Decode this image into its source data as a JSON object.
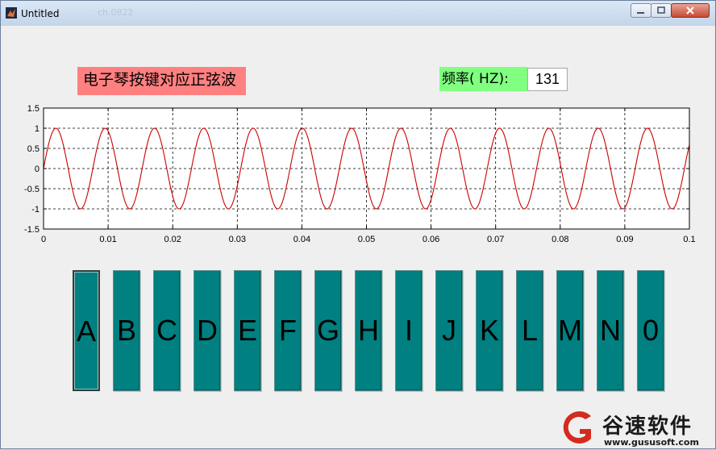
{
  "window": {
    "title": "Untitled",
    "ghost_text": "ch.0822"
  },
  "labels": {
    "heading": "电子琴按键对应正弦波",
    "freq_label": "频率( HZ):",
    "freq_value": "131"
  },
  "keys": [
    "A",
    "B",
    "C",
    "D",
    "E",
    "F",
    "G",
    "H",
    "I",
    "J",
    "K",
    "L",
    "M",
    "N",
    "0"
  ],
  "colors": {
    "key_fill": "#008080",
    "heading_bg": "#ff8080",
    "freq_label_bg": "#80ff80",
    "curve": "#cc0000"
  },
  "watermark": {
    "name": "谷速软件",
    "url": "www.gususoft.com"
  },
  "chart_data": {
    "type": "line",
    "title": "",
    "xlabel": "",
    "ylabel": "",
    "xlim": [
      0,
      0.1
    ],
    "ylim": [
      -1.5,
      1.5
    ],
    "xticks": [
      "0",
      "0.01",
      "0.02",
      "0.03",
      "0.04",
      "0.05",
      "0.06",
      "0.07",
      "0.08",
      "0.09",
      "0.1"
    ],
    "yticks": [
      "1.5",
      "1",
      "0.5",
      "0",
      "-0.5",
      "-1",
      "-1.5"
    ],
    "grid": true,
    "series": [
      {
        "function": "sin(2*pi*131*t)",
        "frequency_hz": 131,
        "amplitude": 1,
        "x_range": [
          0,
          0.1
        ]
      }
    ]
  }
}
